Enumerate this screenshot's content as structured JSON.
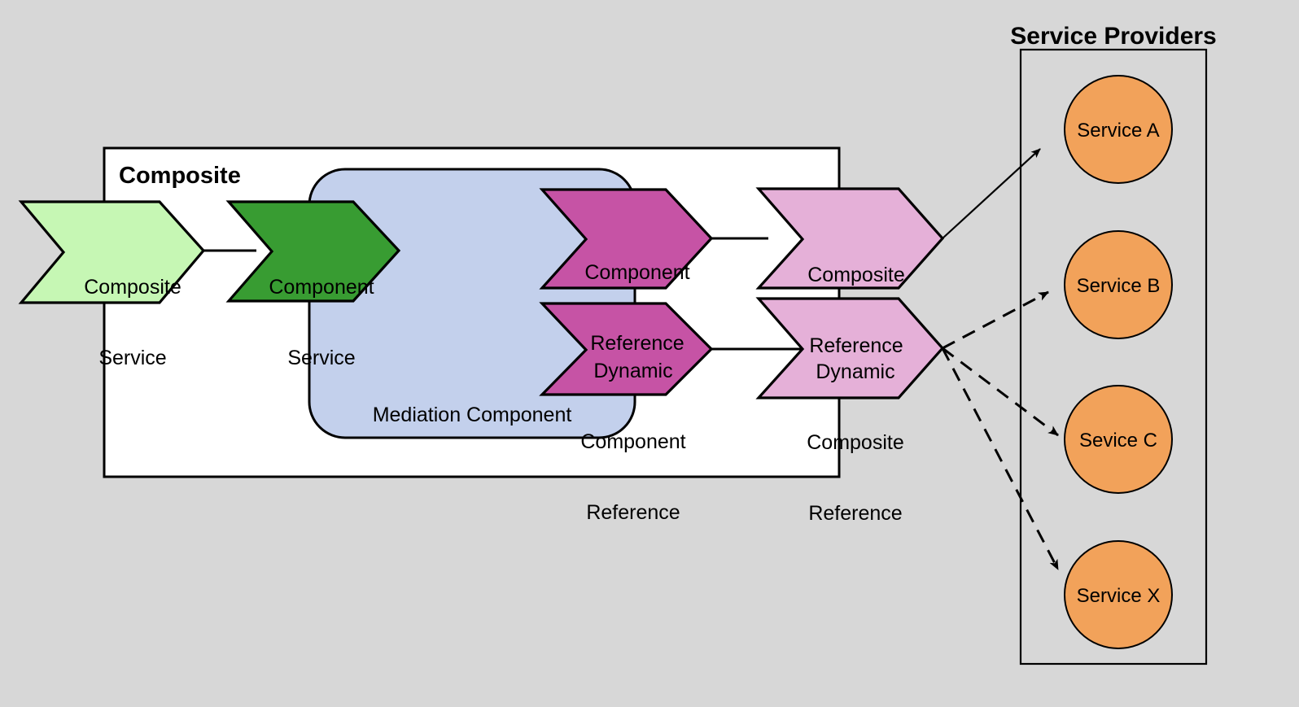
{
  "diagram": {
    "title_composite": "Composite",
    "title_service_providers": "Service Providers",
    "background_color": "#d7d7d7",
    "stroke_color": "#000000"
  },
  "composite_box": {
    "label": "Composite",
    "fill": "#ffffff"
  },
  "mediation_component": {
    "label": "Mediation Component",
    "fill": "#c3d0ec"
  },
  "shapes": [
    {
      "id": "composite-service",
      "line1": "Composite",
      "line2": "Service",
      "line3": "",
      "fill": "#c6f7b4"
    },
    {
      "id": "component-service",
      "line1": "Component",
      "line2": "Service",
      "line3": "",
      "fill": "#389c32"
    },
    {
      "id": "component-reference",
      "line1": "Component",
      "line2": "Reference",
      "line3": "",
      "fill": "#c653a5"
    },
    {
      "id": "composite-reference",
      "line1": "Composite",
      "line2": "Reference",
      "line3": "",
      "fill": "#e5b0d8"
    },
    {
      "id": "dynamic-component-reference",
      "line1": "Dynamic",
      "line2": "Component",
      "line3": "Reference",
      "fill": "#c653a5"
    },
    {
      "id": "dynamic-composite-reference",
      "line1": "Dynamic",
      "line2": "Composite",
      "line3": "Reference",
      "fill": "#e5b0d8"
    }
  ],
  "service_providers": {
    "title": "Service Providers",
    "box_fill": "none",
    "circle_fill": "#f2a25a",
    "services": [
      {
        "id": "service-a",
        "label": "Service A"
      },
      {
        "id": "service-b",
        "label": "Service B"
      },
      {
        "id": "service-c",
        "label": "Sevice C"
      },
      {
        "id": "service-x",
        "label": "Service X"
      }
    ]
  },
  "connectors": [
    {
      "id": "composite-service-to-component-service",
      "style": "solid"
    },
    {
      "id": "component-reference-to-composite-reference",
      "style": "solid"
    },
    {
      "id": "dynamic-component-reference-to-dynamic-composite-reference",
      "style": "solid"
    },
    {
      "id": "composite-reference-to-service-a",
      "style": "solid-arrow"
    },
    {
      "id": "dynamic-composite-reference-to-service-b",
      "style": "dashed-arrow"
    },
    {
      "id": "dynamic-composite-reference-to-service-c",
      "style": "dashed-arrow"
    },
    {
      "id": "dynamic-composite-reference-to-service-x",
      "style": "dashed-arrow"
    }
  ]
}
